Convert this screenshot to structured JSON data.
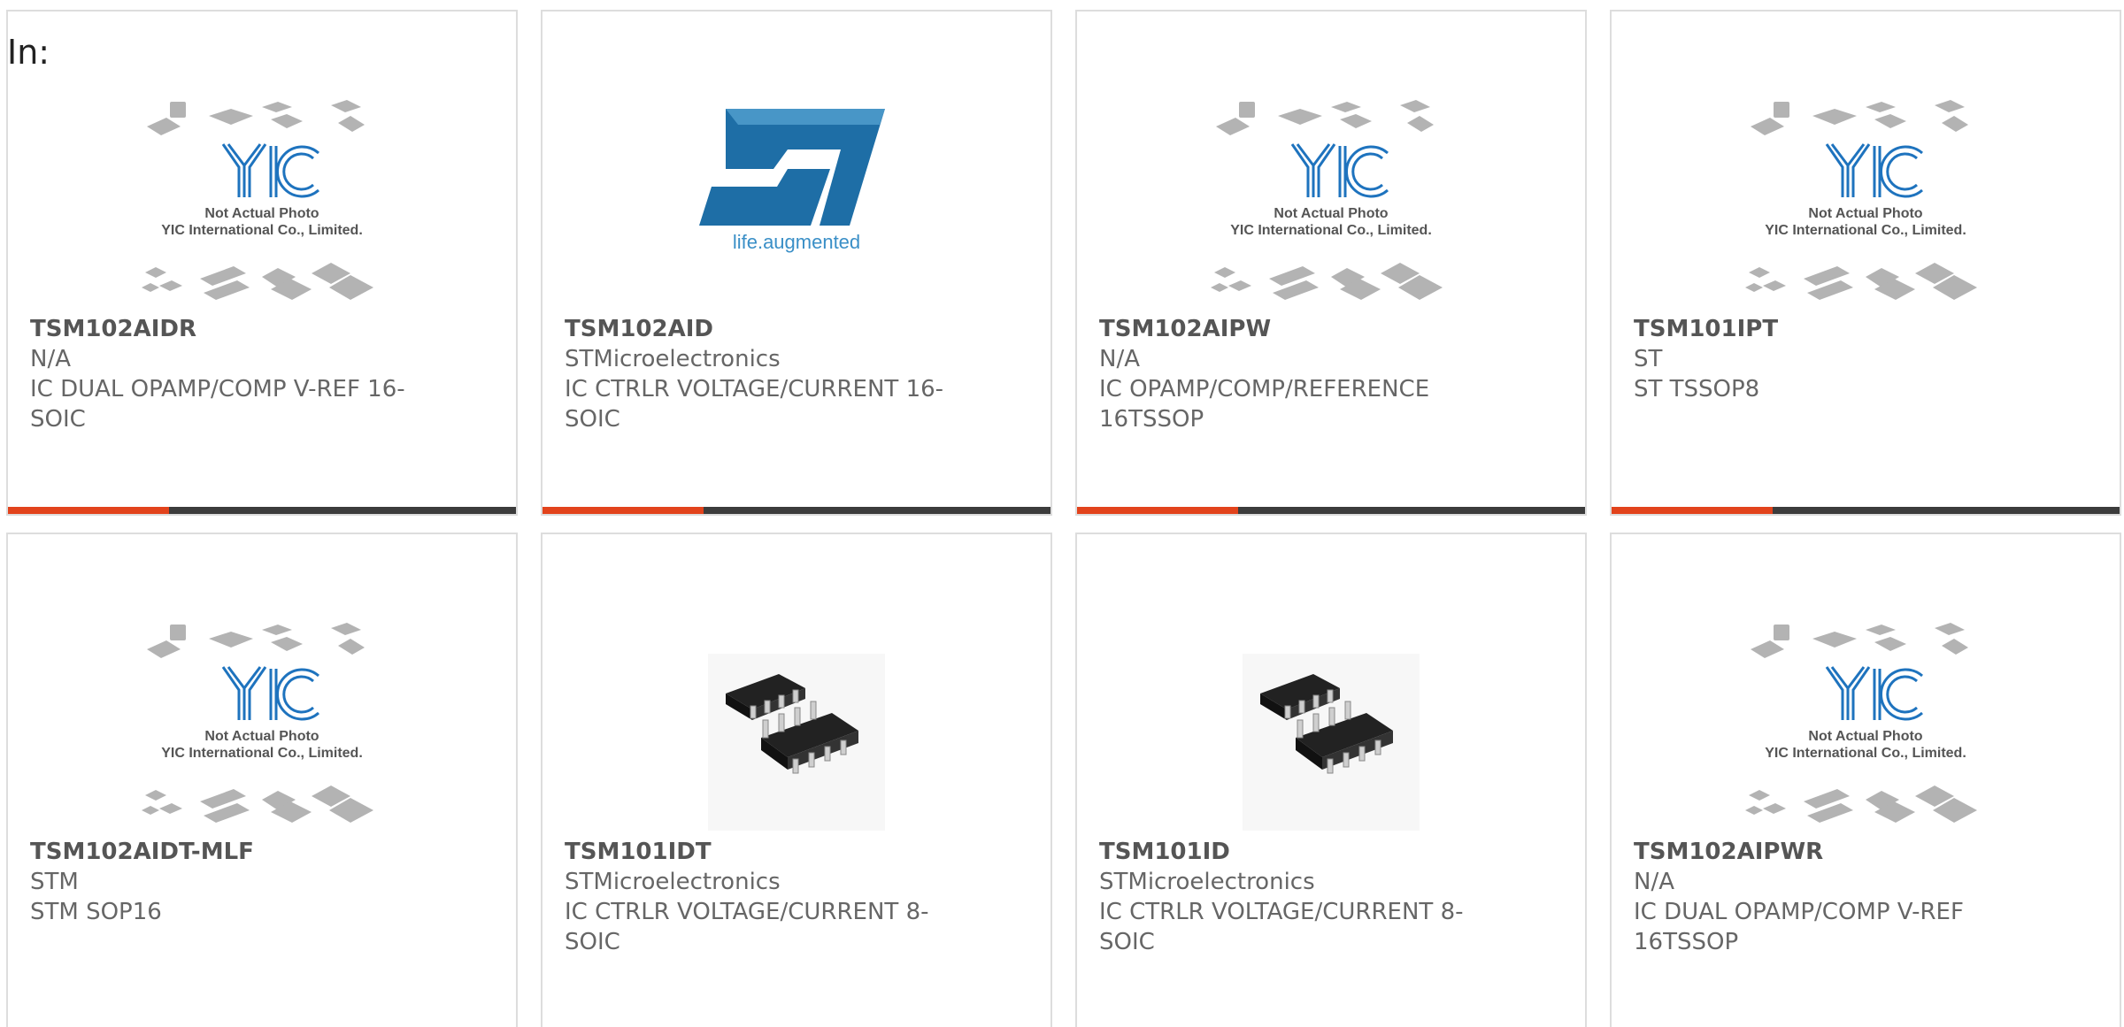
{
  "header": {
    "label": "In:"
  },
  "colors": {
    "accent": "#e2431c",
    "bar": "#3c3c3c",
    "yic_blue": "#1e73be",
    "st_blue": "#1e6ea6"
  },
  "products": [
    {
      "part": "TSM102AIDR",
      "manufacturer": "N/A",
      "description": "IC DUAL OPAMP/COMP V-REF 16-SOIC",
      "image": "yic-placeholder",
      "image_text": [
        "Not Actual Photo",
        "YIC International Co., Limited."
      ]
    },
    {
      "part": "TSM102AID",
      "manufacturer": "STMicroelectronics",
      "description": "IC CTRLR VOLTAGE/CURRENT 16-SOIC",
      "image": "st-logo",
      "image_text": [
        "life.augmented"
      ]
    },
    {
      "part": "TSM102AIPW",
      "manufacturer": "N/A",
      "description": "IC OPAMP/COMP/REFERENCE 16TSSOP",
      "image": "yic-placeholder",
      "image_text": [
        "Not Actual Photo",
        "YIC International Co., Limited."
      ]
    },
    {
      "part": "TSM101IPT",
      "manufacturer": "ST",
      "description": "ST TSSOP8",
      "image": "yic-placeholder",
      "image_text": [
        "Not Actual Photo",
        "YIC International Co., Limited."
      ]
    },
    {
      "part": "TSM102AIDT-MLF",
      "manufacturer": "STM",
      "description": "STM SOP16",
      "image": "yic-placeholder",
      "image_text": [
        "Not Actual Photo",
        "YIC International Co., Limited."
      ]
    },
    {
      "part": "TSM101IDT",
      "manufacturer": "STMicroelectronics",
      "description": "IC CTRLR VOLTAGE/CURRENT 8-SOIC",
      "image": "soic-chip-photo",
      "image_text": []
    },
    {
      "part": "TSM101ID",
      "manufacturer": "STMicroelectronics",
      "description": "IC CTRLR VOLTAGE/CURRENT 8-SOIC",
      "image": "soic-chip-photo",
      "image_text": []
    },
    {
      "part": "TSM102AIPWR",
      "manufacturer": "N/A",
      "description": "IC DUAL OPAMP/COMP V-REF 16TSSOP",
      "image": "yic-placeholder",
      "image_text": [
        "Not Actual Photo",
        "YIC International Co., Limited."
      ]
    }
  ]
}
